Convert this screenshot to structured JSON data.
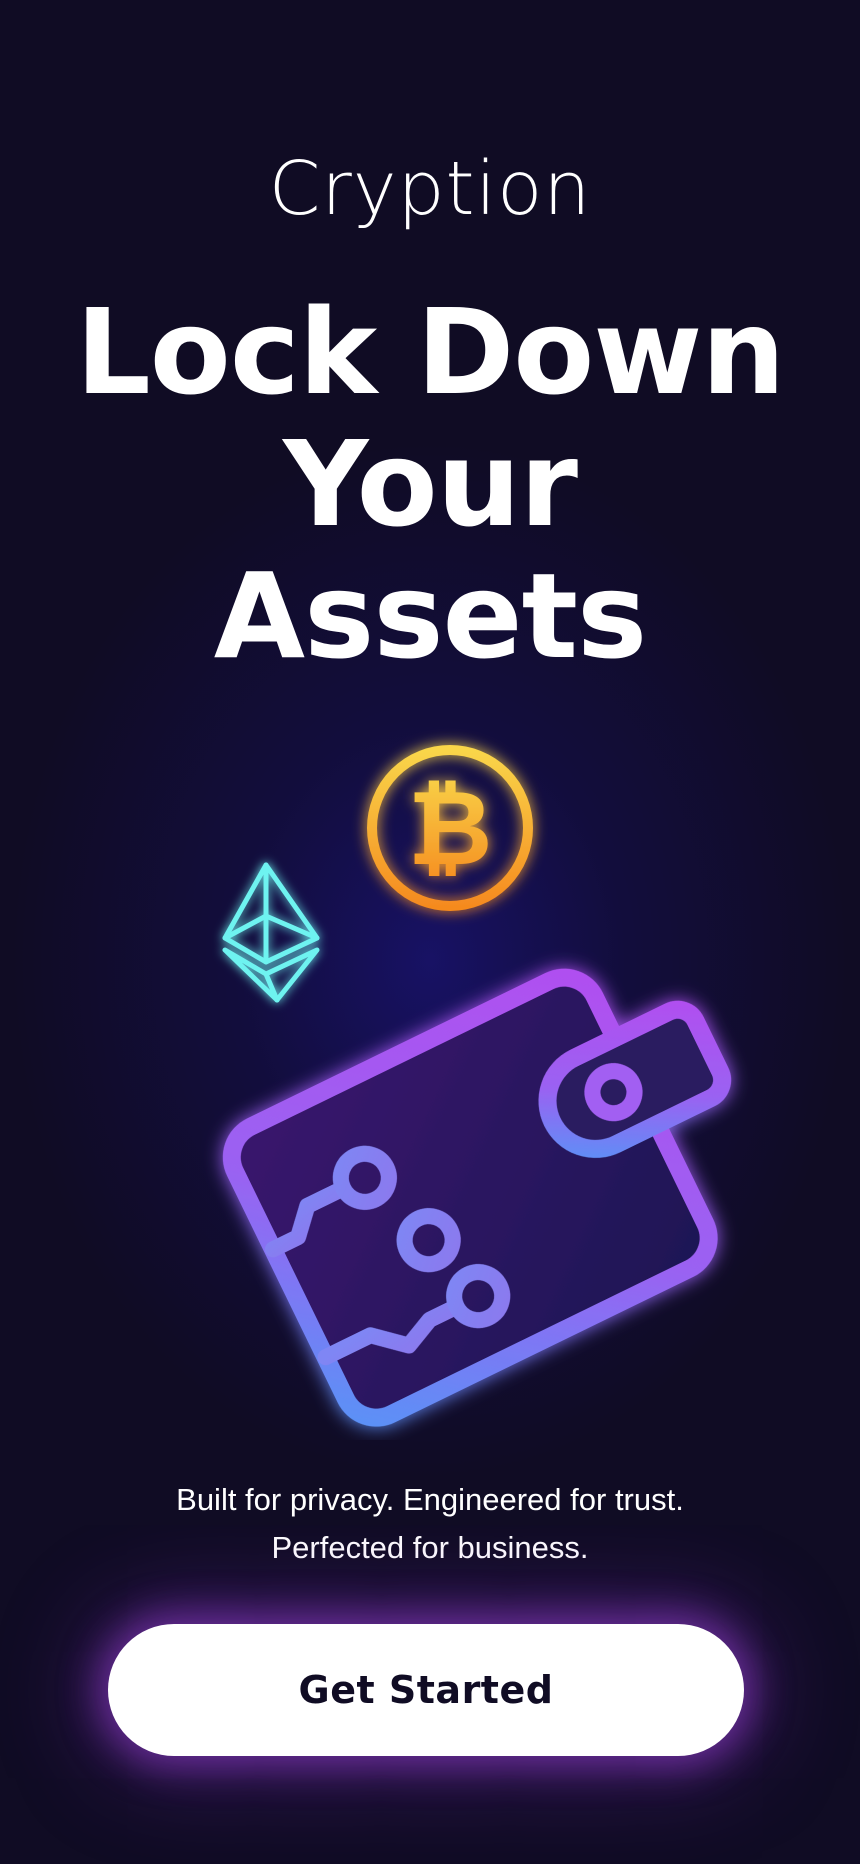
{
  "app": {
    "brand_name": "Cryption"
  },
  "hero": {
    "headline_lines": [
      "Lock Down",
      "Your",
      "Assets"
    ],
    "tagline_lines": [
      "Built for privacy. Engineered for trust.",
      "Perfected for business."
    ]
  },
  "illustration": {
    "icons": [
      "ethereum-icon",
      "bitcoin-icon",
      "crypto-wallet-icon"
    ],
    "bitcoin_symbol": "₿"
  },
  "cta": {
    "label": "Get Started"
  },
  "colors": {
    "background": "#100c24",
    "glow": "#181268",
    "bitcoin_gold": "#f7a21b",
    "ethereum_cyan": "#6ef3f0",
    "wallet_purple": "#a855f7",
    "wallet_blue": "#5b8ef5",
    "button_bg": "#ffffff",
    "button_text": "#100c24"
  }
}
